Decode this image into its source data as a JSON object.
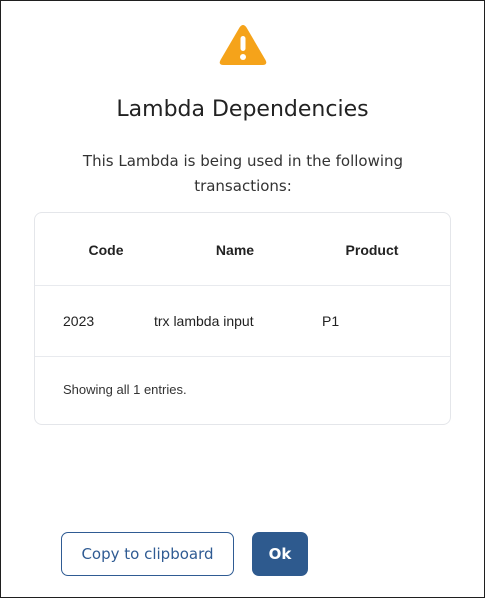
{
  "dialog": {
    "icon": "warning-triangle-icon",
    "icon_color": "#f5a31a",
    "title": "Lambda Dependencies",
    "message": "This Lambda is being used in the following transactions:"
  },
  "table": {
    "headers": {
      "code": "Code",
      "name": "Name",
      "product": "Product"
    },
    "rows": [
      {
        "code": "2023",
        "name": "trx lambda input",
        "product": "P1"
      }
    ],
    "footer": "Showing all 1 entries."
  },
  "actions": {
    "copy_label": "Copy to clipboard",
    "ok_label": "Ok",
    "primary_color": "#2e5a8e"
  }
}
